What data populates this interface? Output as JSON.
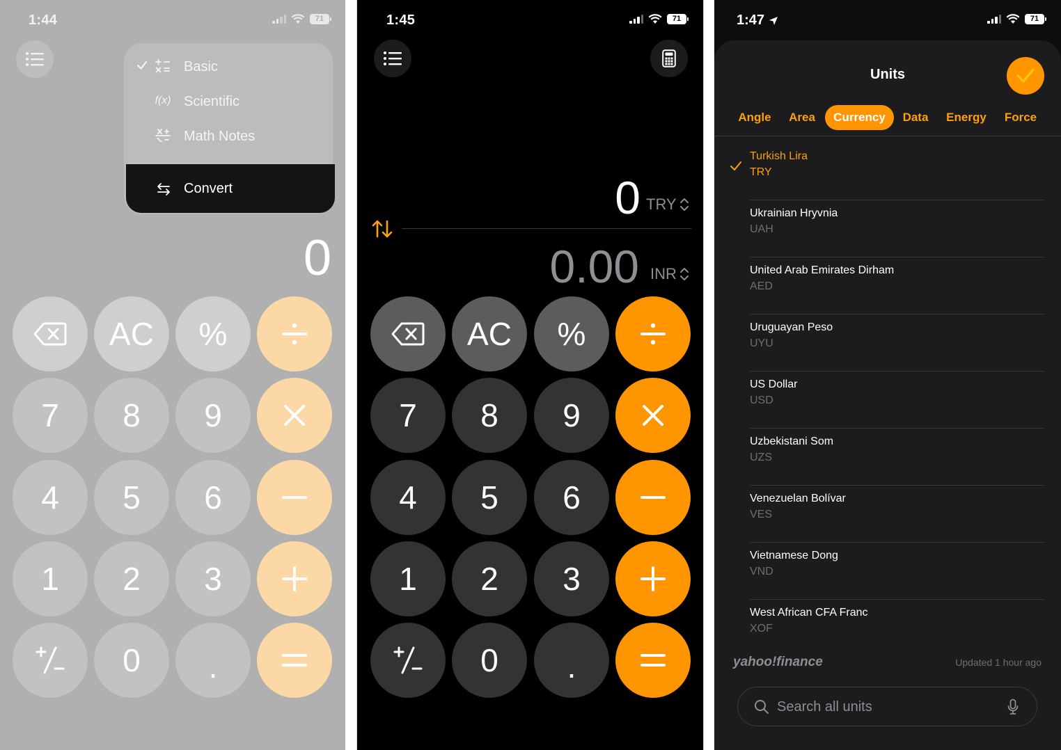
{
  "screens": [
    {
      "status": {
        "time": "1:44",
        "battery": "71"
      },
      "menu": {
        "items": [
          {
            "label": "Basic",
            "checked": true,
            "icon": "basic-ops-icon"
          },
          {
            "label": "Scientific",
            "checked": false,
            "icon": "function-icon",
            "glyph": "f(x)"
          },
          {
            "label": "Math Notes",
            "checked": false,
            "icon": "math-notes-icon"
          }
        ],
        "convert": {
          "label": "Convert",
          "icon": "convert-arrows-icon"
        }
      },
      "display": "0",
      "keys": [
        "",
        "AC",
        "%",
        "",
        "7",
        "8",
        "9",
        "",
        "4",
        "5",
        "6",
        "",
        "1",
        "2",
        "3",
        "",
        "",
        "0",
        ".",
        ""
      ]
    },
    {
      "status": {
        "time": "1:45",
        "battery": "71"
      },
      "top_value": "0",
      "top_unit": "TRY",
      "bottom_value": "0.00",
      "bottom_unit": "INR",
      "keys": [
        "",
        "AC",
        "%",
        "",
        "7",
        "8",
        "9",
        "",
        "4",
        "5",
        "6",
        "",
        "1",
        "2",
        "3",
        "",
        "",
        "0",
        ".",
        ""
      ]
    },
    {
      "status": {
        "time": "1:47",
        "battery": "71"
      },
      "title": "Units",
      "tabs": [
        "Angle",
        "Area",
        "Currency",
        "Data",
        "Energy",
        "Force"
      ],
      "active_tab": "Currency",
      "currencies": [
        {
          "name": "Turkish Lira",
          "code": "TRY",
          "selected": true
        },
        {
          "name": "Ukrainian Hryvnia",
          "code": "UAH"
        },
        {
          "name": "United Arab Emirates Dirham",
          "code": "AED"
        },
        {
          "name": "Uruguayan Peso",
          "code": "UYU"
        },
        {
          "name": "US Dollar",
          "code": "USD"
        },
        {
          "name": "Uzbekistani Som",
          "code": "UZS"
        },
        {
          "name": "Venezuelan Bolívar",
          "code": "VES"
        },
        {
          "name": "Vietnamese Dong",
          "code": "VND"
        },
        {
          "name": "West African CFA Franc",
          "code": "XOF"
        }
      ],
      "footer": {
        "provider": "yahoo!finance",
        "updated": "Updated 1 hour ago"
      },
      "search": {
        "placeholder": "Search all units"
      }
    }
  ],
  "colors": {
    "accent": "#ff9500",
    "accent_text": "#ff9f0a",
    "sheet": "#1c1c1e",
    "key_dark": "#333333",
    "key_mid": "#5c5c5c"
  }
}
